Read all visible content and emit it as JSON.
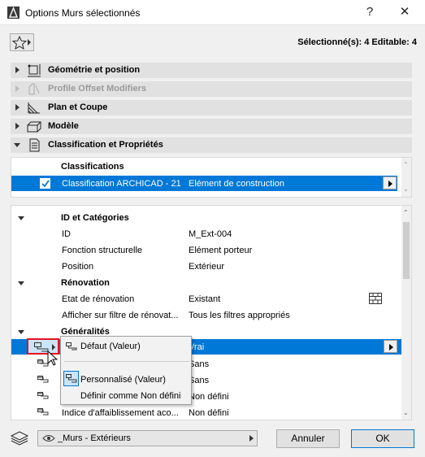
{
  "window": {
    "title": "Options Murs sélectionnés",
    "help": "?",
    "close": "✕"
  },
  "header": {
    "selection_info": "Sélectionné(s): 4 Editable: 4"
  },
  "categories": [
    {
      "label": "Géométrie et position",
      "icon": "geometry-icon",
      "enabled": true,
      "expanded": false
    },
    {
      "label": "Profile Offset Modifiers",
      "icon": "profile-offset-icon",
      "enabled": false,
      "expanded": false
    },
    {
      "label": "Plan et Coupe",
      "icon": "plan-section-icon",
      "enabled": true,
      "expanded": false
    },
    {
      "label": "Modèle",
      "icon": "model-icon",
      "enabled": true,
      "expanded": false
    },
    {
      "label": "Classification et Propriétés",
      "icon": "classification-icon",
      "enabled": true,
      "expanded": true
    }
  ],
  "classifications": {
    "heading": "Classifications",
    "row": {
      "system": "Classification ARCHICAD - 21",
      "value": "Elément de construction",
      "checked": true
    }
  },
  "properties": {
    "id_section": {
      "heading": "ID et Catégories",
      "rows": [
        {
          "label": "ID",
          "value": "M_Ext-004"
        },
        {
          "label": "Fonction structurelle",
          "value": "Elément porteur"
        },
        {
          "label": "Position",
          "value": "Extérieur"
        }
      ]
    },
    "renovation_section": {
      "heading": "Rénovation",
      "rows": [
        {
          "label": "Etat de rénovation",
          "value": "Existant"
        },
        {
          "label": "Afficher sur filtre de rénovat...",
          "value": "Tous les filtres appropriés"
        }
      ]
    },
    "general_section": {
      "heading": "Généralités",
      "rows": [
        {
          "label": "",
          "value": "Vrai"
        },
        {
          "label": "",
          "value": "Sans"
        },
        {
          "label": "",
          "value": "Sans"
        },
        {
          "label": "",
          "value": "Non défini"
        },
        {
          "label": "Indice d'affaiblissement aco...",
          "value": "Non défini"
        }
      ]
    }
  },
  "popup_menu": {
    "items": [
      {
        "label": "Défaut (Valeur)",
        "icon": "link-icon"
      },
      {
        "label": "Personnalisé (Valeur)",
        "icon": "link-icon"
      },
      {
        "label": "Définir comme Non défini",
        "icon": ""
      }
    ]
  },
  "footer": {
    "layer_value": "_Murs - Extérieurs",
    "cancel": "Annuler",
    "ok": "OK"
  },
  "colors": {
    "selection": "#0078d7",
    "highlight_box": "#e81123"
  }
}
